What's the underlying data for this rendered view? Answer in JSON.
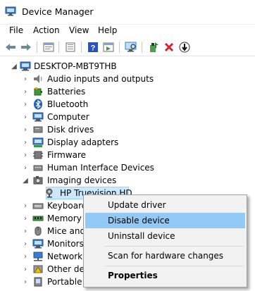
{
  "window": {
    "title": "Device Manager"
  },
  "menu": [
    "File",
    "Action",
    "View",
    "Help"
  ],
  "toolbar": [
    "back-icon",
    "forward-icon",
    "properties-icon",
    "show-hide-icon",
    "help-icon",
    "action-pane-icon",
    "scan-hardware-icon",
    "update-driver-icon",
    "uninstall-icon",
    "disable-icon"
  ],
  "tree": {
    "root": "DESKTOP-MBT9THB",
    "categories": [
      "Audio inputs and outputs",
      "Batteries",
      "Bluetooth",
      "Computer",
      "Disk drives",
      "Display adapters",
      "Firmware",
      "Human Interface Devices",
      "Imaging devices",
      "HP Truevision HD",
      "Keyboards",
      "Memory technology devices",
      "Mice and other pointing devices",
      "Monitors",
      "Network adapters",
      "Other devices",
      "Portable Devices"
    ],
    "visible_labels": [
      "Audio inputs and outputs",
      "Batteries",
      "Bluetooth",
      "Computer",
      "Disk drives",
      "Display adapters",
      "Firmware",
      "Human Interface Devices",
      "Imaging devices",
      "HP Truevision HD",
      "Keyboard",
      "Memory t",
      "Mice and",
      "Monitors",
      "Network a",
      "Other dev",
      "Portable D"
    ]
  },
  "context_menu": {
    "update_driver": "Update driver",
    "disable_device": "Disable device",
    "uninstall_device": "Uninstall device",
    "scan_hardware": "Scan for hardware changes",
    "properties": "Properties"
  },
  "colors": {
    "selection": "#cce8ff",
    "menu_hover": "#91c9f7",
    "accent": "#0078d7"
  }
}
